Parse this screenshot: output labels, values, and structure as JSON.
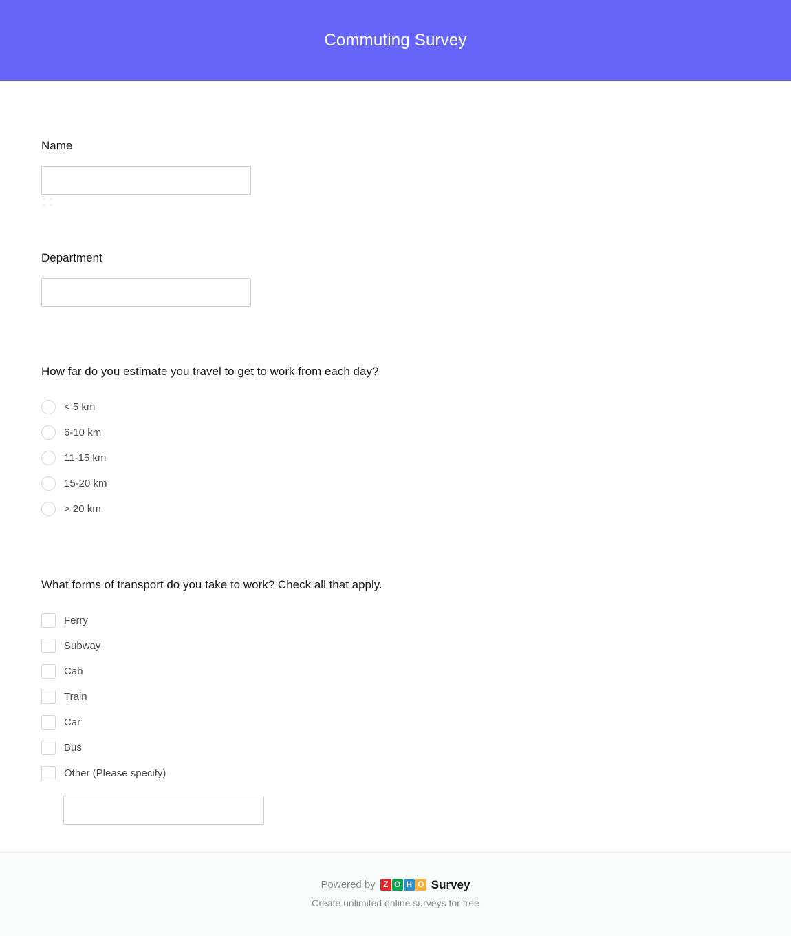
{
  "header": {
    "title": "Commuting Survey",
    "background_color": "#6666fa",
    "text_color": "#ffffff"
  },
  "form": {
    "fields": [
      {
        "id": "name",
        "label": "Name",
        "type": "text",
        "value": "",
        "placeholder": ""
      },
      {
        "id": "department",
        "label": "Department",
        "type": "text",
        "value": "",
        "placeholder": ""
      }
    ],
    "questions": [
      {
        "id": "distance",
        "text": "How far do you estimate you travel to get to work from each day?",
        "type": "radio",
        "selected": null,
        "options": [
          {
            "label": "< 5 km"
          },
          {
            "label": "6-10 km"
          },
          {
            "label": "11-15 km"
          },
          {
            "label": "15-20 km"
          },
          {
            "label": "> 20 km"
          }
        ]
      },
      {
        "id": "transport",
        "text": "What forms of transport do you take to work? Check all that apply.",
        "type": "checkbox",
        "options": [
          {
            "label": "Ferry",
            "checked": false
          },
          {
            "label": "Subway",
            "checked": false
          },
          {
            "label": "Cab",
            "checked": false
          },
          {
            "label": "Train",
            "checked": false
          },
          {
            "label": "Car",
            "checked": false
          },
          {
            "label": "Bus",
            "checked": false
          },
          {
            "label": "Other (Please specify)",
            "checked": false,
            "has_text_input": true
          }
        ],
        "other_value": "",
        "other_placeholder": ""
      }
    ]
  },
  "footer": {
    "powered_by": "Powered by",
    "brand_letters": [
      "Z",
      "O",
      "H",
      "O"
    ],
    "brand_colors": [
      "#e42527",
      "#00a94f",
      "#2b8fd4",
      "#fbb034"
    ],
    "product": "Survey",
    "tagline": "Create unlimited online surveys for free",
    "background_color": "#fafbfb"
  }
}
